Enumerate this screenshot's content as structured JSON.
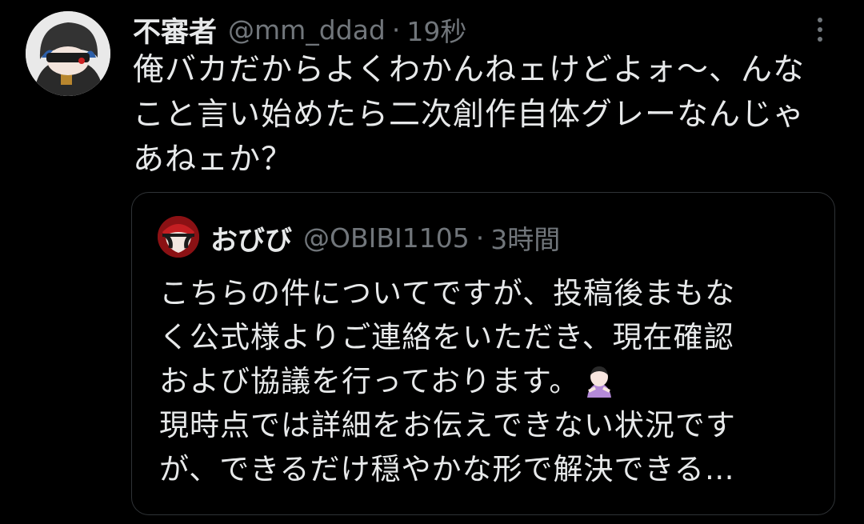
{
  "tweet": {
    "author_name": "不審者",
    "author_handle": "@mm_ddad",
    "separator": "·",
    "time": "19秒",
    "text": "俺バカだからよくわかんねェけどよォ〜、んな\nこと言い始めたら二次創作自体グレーなんじゃ\nあねェか？"
  },
  "quoted": {
    "author_name": "おびび",
    "author_handle": "@OBIBI1105",
    "separator": "·",
    "time": "3時間",
    "text_line1": "こちらの件についてですが、投稿後まもな\nく公式様よりご連絡をいただき、現在確認\nおよび協議を行っております。",
    "emoji": "person-bowing-emoji",
    "text_line2": "\n現時点では詳細をお伝えできない状況です\nが、できるだけ穏やかな形で解決できる…"
  },
  "icons": {
    "more": "more-vertical-icon"
  },
  "colors": {
    "background": "#000000",
    "primary_text": "#e7e9ea",
    "secondary_text": "#71767b",
    "border": "#2f3336"
  }
}
